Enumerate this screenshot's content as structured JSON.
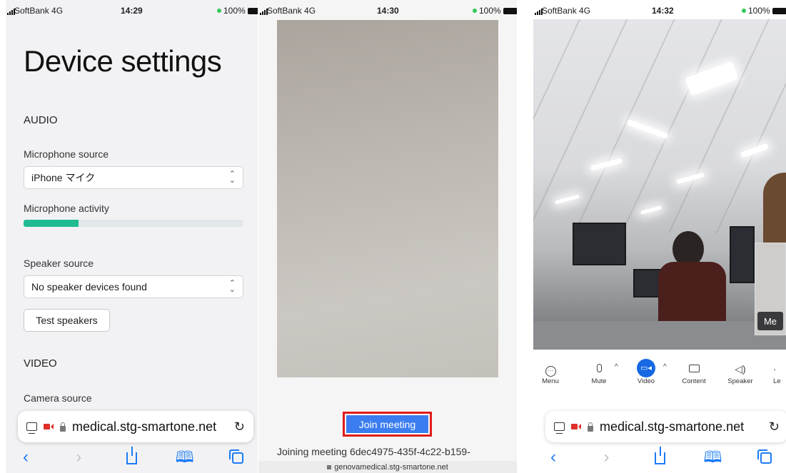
{
  "panel1": {
    "status": {
      "carrier": "SoftBank 4G",
      "time": "14:29",
      "battery": "100%"
    },
    "title": "Device settings",
    "audio_heading": "AUDIO",
    "mic_source_label": "Microphone source",
    "mic_source_value": "iPhone マイク",
    "mic_activity_label": "Microphone activity",
    "mic_activity_level": 0.25,
    "speaker_source_label": "Speaker source",
    "speaker_source_value": "No speaker devices found",
    "test_speakers_label": "Test speakers",
    "video_heading": "VIDEO",
    "camera_source_label": "Camera source",
    "url": "medical.stg-smartone.net"
  },
  "panel2": {
    "status": {
      "carrier": "SoftBank 4G",
      "time": "14:30",
      "battery": "100%"
    },
    "join_label": "Join meeting",
    "joining_text": "Joining meeting 6dec4975-435f-4c22-b159-",
    "domain": "genovamedical.stg-smartone.net"
  },
  "panel3": {
    "status": {
      "carrier": "SoftBank 4G",
      "time": "14:32",
      "battery": "100%"
    },
    "me_label": "Me",
    "controls": {
      "menu": "Menu",
      "mute": "Mute",
      "video": "Video",
      "content": "Content",
      "speaker": "Speaker",
      "leave": "Le"
    },
    "url": "medical.stg-smartone.net"
  },
  "colors": {
    "meter": "#20bb93",
    "join_button": "#3b7df0",
    "highlight": "#e11a1a",
    "video_active": "#1668e3",
    "safari_blue": "#1b7cf5"
  },
  "icons": [
    "signal-icon",
    "battery-icon",
    "chevron-updown-icon",
    "tabs-icon",
    "camera-icon",
    "lock-icon",
    "reload-icon",
    "back-icon",
    "forward-icon",
    "share-icon",
    "bookmarks-icon",
    "tabs-overview-icon",
    "menu-icon",
    "mic-icon",
    "video-icon",
    "screen-icon",
    "speaker-icon"
  ]
}
